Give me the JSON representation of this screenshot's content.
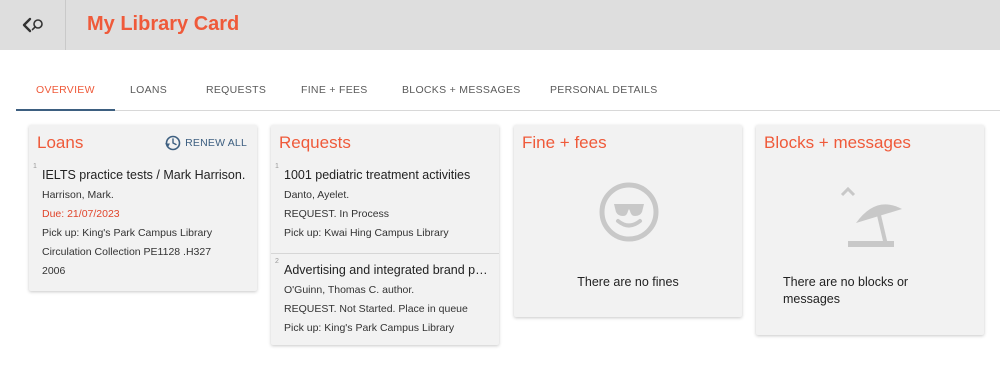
{
  "header": {
    "title": "My Library Card"
  },
  "tabs": [
    {
      "label": "OVERVIEW",
      "active": true
    },
    {
      "label": "LOANS"
    },
    {
      "label": "REQUESTS"
    },
    {
      "label": "FINE + FEES"
    },
    {
      "label": "BLOCKS + MESSAGES"
    },
    {
      "label": "PERSONAL DETAILS"
    }
  ],
  "loans": {
    "title": "Loans",
    "renew_label": "RENEW ALL",
    "items": [
      {
        "num": "1",
        "title": "IELTS practice tests / Mark Harrison.",
        "author": "Harrison, Mark.",
        "due": "Due: 21/07/2023",
        "pickup": "Pick up: King's Park Campus Library",
        "collection": "Circulation Collection PE1128 .H327",
        "year": "2006"
      }
    ]
  },
  "requests": {
    "title": "Requests",
    "items": [
      {
        "num": "1",
        "title": "1001 pediatric treatment activities",
        "author": "Danto, Ayelet.",
        "status": "REQUEST. In Process",
        "pickup": "Pick up: Kwai Hing Campus Library"
      },
      {
        "num": "2",
        "title": "Advertising and integrated brand promotion",
        "author": "O'Guinn, Thomas C. author.",
        "status": "REQUEST. Not Started. Place in queue",
        "pickup": "Pick up: King's Park Campus Library"
      }
    ]
  },
  "fines": {
    "title": "Fine + fees",
    "empty_text": "There are no fines",
    "icon": "smiley-sunglasses-icon"
  },
  "blocks": {
    "title": "Blocks + messages",
    "empty_line1": "There are no blocks or",
    "empty_line2": "messages",
    "icon": "beach-umbrella-icon"
  },
  "colors": {
    "accent": "#ef5a3a",
    "link": "#3d5f80",
    "header_bg": "#dedede",
    "card_bg": "#f2f2f2"
  }
}
